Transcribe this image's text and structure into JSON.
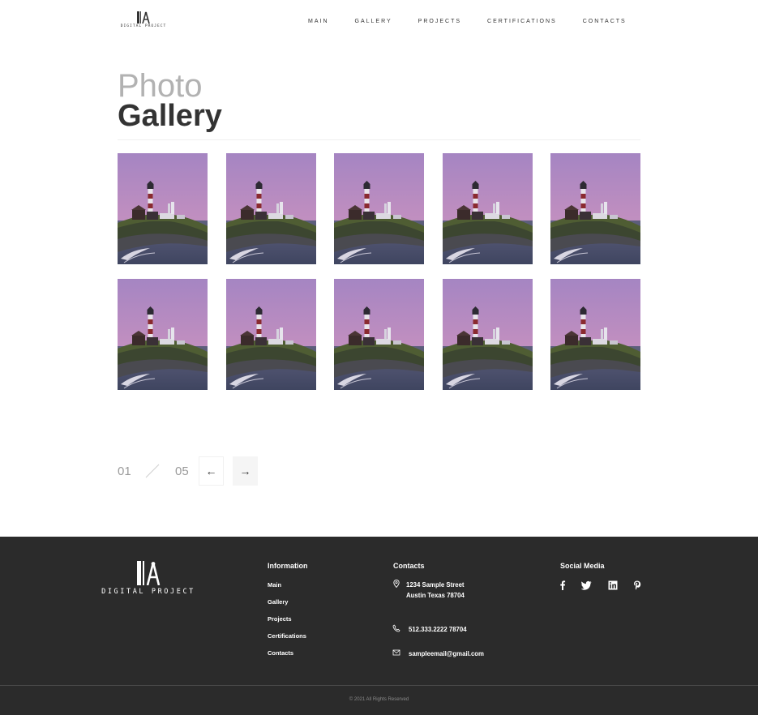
{
  "brand": {
    "logo_text": "DIGITAL PROJECT"
  },
  "nav": {
    "items": [
      "MAIN",
      "GALLERY",
      "PROJECTS",
      "CERTIFICATIONS",
      "CONTACTS"
    ]
  },
  "heading": {
    "light": "Photo",
    "bold": "Gallery"
  },
  "gallery": {
    "photo_icon": "lighthouse-photo",
    "count": 10
  },
  "pagination": {
    "current": "01",
    "total": "05",
    "prev_icon": "arrow-left-icon",
    "next_icon": "arrow-right-icon"
  },
  "footer": {
    "logo_text": "DIGITAL PROJECT",
    "information": {
      "title": "Information",
      "links": [
        "Main",
        "Gallery",
        "Projects",
        "Certifications",
        "Contacts"
      ]
    },
    "contacts": {
      "title": "Contacts",
      "address_line1": "1234 Sample Street",
      "address_line2": "Austin Texas 78704",
      "phone": "512.333.2222 78704",
      "email": "sampleemail@gmail.com"
    },
    "social": {
      "title": "Social Media",
      "icons": [
        "facebook-icon",
        "twitter-icon",
        "linkedin-icon",
        "pinterest-icon"
      ]
    },
    "copyright": "© 2021 All Rights Reserved"
  },
  "colors": {
    "footer_bg": "#2b2b2b",
    "heading_light": "#b2b2b2",
    "text_dark": "#333333"
  }
}
